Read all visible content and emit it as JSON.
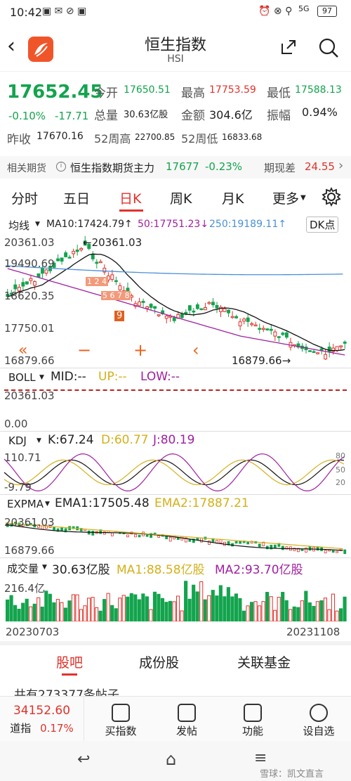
{
  "status": {
    "time": "10:42",
    "battery": "97",
    "network": "5G"
  },
  "header": {
    "title": "恒生指数",
    "subtitle": "HSI"
  },
  "quote": {
    "price": "17652.45",
    "change_pct": "-0.10%",
    "change": "-17.71",
    "open_label": "今开",
    "open": "17650.51",
    "high_label": "最高",
    "high": "17753.59",
    "low_label": "最低",
    "low": "17588.13",
    "volume_label": "总量",
    "volume": "30.63亿股",
    "amount_label": "金额",
    "amount": "304.6亿",
    "amplitude_label": "振幅",
    "amplitude": "0.94%",
    "prev_close_label": "昨收",
    "prev_close": "17670.16",
    "wk52_high_label": "52周高",
    "wk52_high": "22700.85",
    "wk52_low_label": "52周低",
    "wk52_low": "16833.68"
  },
  "futures": {
    "label": "相关期货",
    "name": "恒生指数期货主力",
    "price": "17677",
    "change": "-0.23%",
    "basis_label": "期现差",
    "basis": "24.55"
  },
  "tabs": [
    "分时",
    "五日",
    "日K",
    "周K",
    "月K",
    "更多"
  ],
  "active_tab": 2,
  "main_chart": {
    "ma_toggle": "均线",
    "ma10": "MA10:17424.79↑",
    "ma50": "50:17751.23↓",
    "ma250": "250:19189.11↑",
    "dk": "DK点",
    "y_labels": [
      "20361.03",
      "19490.69",
      "18620.35",
      "17750.01",
      "16879.66"
    ],
    "high_annot": "←20361.03",
    "low_annot": "16879.66→"
  },
  "boll": {
    "name": "BOLL",
    "mid": "MID:--",
    "up": "UP:--",
    "low": "LOW:--",
    "top": "20361.03",
    "bottom": "0.00"
  },
  "kdj": {
    "name": "KDJ",
    "k": "K:67.24",
    "d": "D:60.77",
    "j": "J:80.19",
    "top": "110.71",
    "bottom": "-9.79",
    "r1": "80",
    "r2": "50",
    "r3": "20"
  },
  "expma": {
    "name": "EXPMA",
    "ema1": "EMA1:17505.48",
    "ema2": "EMA2:17887.21",
    "top": "20361.03",
    "bottom": "16879.66"
  },
  "volume": {
    "name": "成交量",
    "value": "30.63亿股",
    "ma1": "MA1:88.58亿股",
    "ma2": "MA2:93.70亿股",
    "top": "216.4亿",
    "start": "20230703",
    "end": "20231108"
  },
  "segments": [
    "股吧",
    "成份股",
    "关联基金"
  ],
  "posts_text": "共有273377条帖子",
  "bottom_nav": {
    "dji_value": "34152.60",
    "dji_name": "道指",
    "dji_change": "0.17%",
    "items": [
      "买指数",
      "发帖",
      "功能",
      "设自选"
    ]
  },
  "watermark": "雪球：凯文直言",
  "colors": {
    "up": "#e0322b",
    "down": "#13a44d",
    "ma10": "#111111",
    "ma50": "#a020a0",
    "ma250": "#4a90d9",
    "ema2": "#d4b01a"
  }
}
